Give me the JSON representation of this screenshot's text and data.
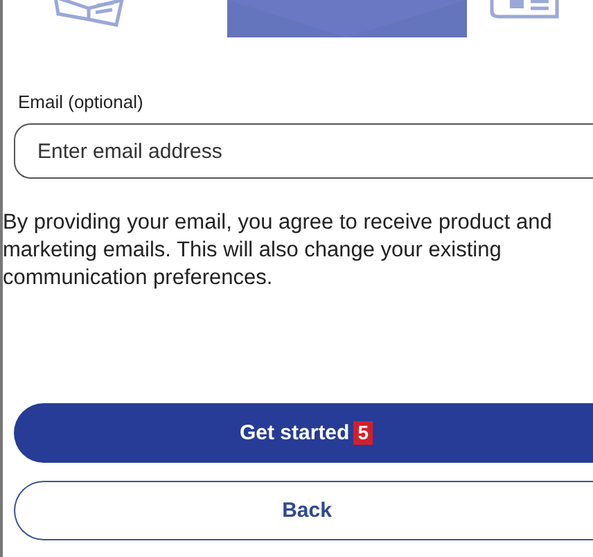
{
  "email_field": {
    "label": "Email (optional)",
    "placeholder": "Enter email address"
  },
  "consent_text": "By providing your email, you agree to receive product and marketing emails. This will also change your existing communication preferences.",
  "buttons": [
    {
      "kind": "primary",
      "label": "Get started",
      "badge": "5"
    },
    {
      "kind": "secondary",
      "label": "Back"
    }
  ]
}
